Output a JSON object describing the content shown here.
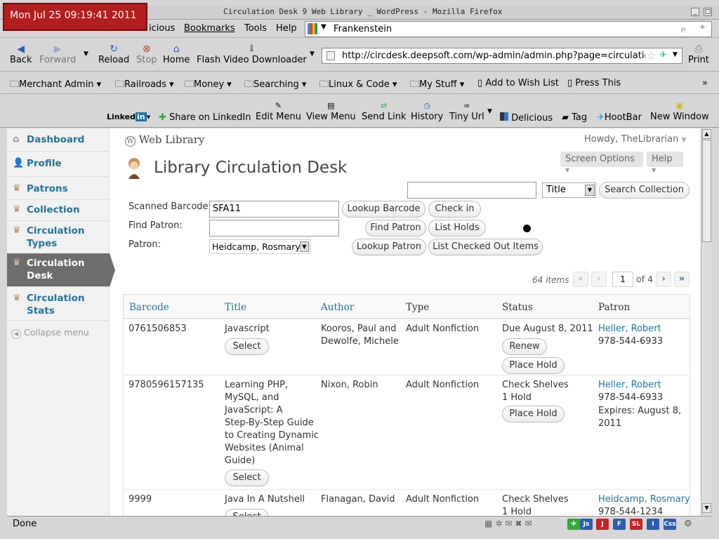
{
  "clock": "Mon Jul 25 09:19:41 2011",
  "window_title": "Circulation Desk  9 Web Library  _ WordPress - Mozilla Firefox",
  "menu": {
    "partial": "icious",
    "bookmarks": "Bookmarks",
    "tools": "Tools",
    "help": "Help"
  },
  "search_engine_value": "Frankenstein",
  "nav": {
    "back": "Back",
    "forward": "Forward",
    "reload": "Reload",
    "stop": "Stop",
    "home": "Home",
    "flash": "Flash Video Downloader",
    "print": "Print"
  },
  "url": "http://circdesk.deepsoft.com/wp-admin/admin.php?page=circulatic",
  "bookmarks": [
    "Merchant Admin",
    "Railroads",
    "Money",
    "Searching",
    "Linux & Code",
    "My Stuff",
    "Add to Wish List",
    "Press This"
  ],
  "linkbar": {
    "linkedin": "Linked",
    "share": "Share on LinkedIn",
    "edit_menu": "Edit Menu",
    "view_menu": "View Menu",
    "send_link": "Send Link",
    "history": "History",
    "tiny_url": "Tiny Url",
    "delicious": "Delicious",
    "tag": "Tag",
    "hootbar": "HootBar",
    "new_window": "New Window"
  },
  "sidebar": {
    "dashboard": "Dashboard",
    "profile": "Profile",
    "patrons": "Patrons",
    "collection": "Collection",
    "circ_types_1": "Circulation",
    "circ_types_2": "Types",
    "circ_desk_1": "Circulation",
    "circ_desk_2": "Desk",
    "circ_stats_1": "Circulation",
    "circ_stats_2": "Stats",
    "collapse": "Collapse menu"
  },
  "site_name": "Web Library",
  "howdy": "Howdy, TheLibrarian",
  "screen_options": "Screen Options",
  "help": "Help",
  "page_title": "Library Circulation Desk",
  "search": {
    "value": "",
    "field": "Title",
    "button": "Search Collection"
  },
  "form": {
    "barcode_label": "Scanned Barcode",
    "barcode_value": "SFA11",
    "lookup_barcode": "Lookup Barcode",
    "check_in": "Check in",
    "find_patron_label": "Find Patron:",
    "find_patron_btn": "Find Patron",
    "list_holds": "List Holds",
    "patron_label": "Patron:",
    "patron_value": "Heidcamp, Rosmary",
    "lookup_patron": "Lookup Patron",
    "list_checked_out": "List Checked Out Items"
  },
  "pagination": {
    "items": "64 items",
    "first": "«",
    "prev": "‹",
    "current": "1",
    "of": "of 4",
    "next": "›",
    "last": "»"
  },
  "table": {
    "headers": {
      "barcode": "Barcode",
      "title": "Title",
      "author": "Author",
      "type": "Type",
      "status": "Status",
      "patron": "Patron"
    },
    "select": "Select",
    "renew": "Renew",
    "place_hold": "Place Hold",
    "rows": [
      {
        "barcode": "0761506853",
        "title": "Javascript",
        "author_1": "Kooros, Paul and",
        "author_2": "Dewolfe, Michele",
        "type": "Adult Nonfiction",
        "status": "Due August 8, 2011",
        "patron": "Heller, Robert",
        "phone": "978-544-6933"
      },
      {
        "barcode": "9780596157135",
        "title_lines": [
          "Learning PHP,",
          "MySQL, and",
          "JavaScript: A",
          "Step-By-Step Guide",
          "to Creating Dynamic",
          "Websites (Animal",
          "Guide)"
        ],
        "author": "Nixon, Robin",
        "type": "Adult Nonfiction",
        "status_1": "Check Shelves",
        "status_2": "1 Hold",
        "patron": "Heller, Robert",
        "phone": "978-544-6933",
        "expires_1": "Expires: August 8,",
        "expires_2": "2011"
      },
      {
        "barcode": "9999",
        "title": "Java In A Nutshell",
        "author": "Flanagan, David",
        "type": "Adult Nonfiction",
        "status_1": "Check Shelves",
        "status_2": "1 Hold",
        "patron": "Heidcamp, Rosmary",
        "phone": "978-544-1234"
      }
    ]
  },
  "statusbar": "Done",
  "status_icons": [
    "Js",
    "J",
    "F",
    "SL",
    "I",
    "Css"
  ],
  "colors": {
    "link": "#21759b",
    "clock_bg": "#b21e1e",
    "active_menu": "#6d6d6d"
  }
}
